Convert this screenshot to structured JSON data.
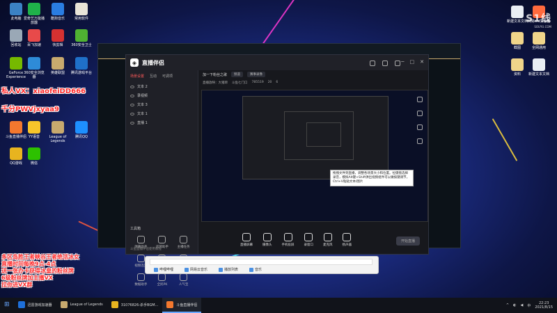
{
  "desktop_left": [
    {
      "label": "此电脑",
      "color": "#3b82c4"
    },
    {
      "label": "爱奇艺万能播放器",
      "color": "#1fb14a"
    },
    {
      "label": "酷狗音乐",
      "color": "#2a7de1"
    },
    {
      "label": "常用软件",
      "color": "#e8e4d8"
    },
    {
      "label": "回收站",
      "color": "#9aa8b6"
    },
    {
      "label": "百飞加速",
      "color": "#e84a4a"
    },
    {
      "label": "快剪辑",
      "color": "#d63131"
    },
    {
      "label": "360安全卫士",
      "color": "#4fb232"
    },
    {
      "label": "GeForce Experience",
      "color": "#76b900"
    },
    {
      "label": "360安全浏览器",
      "color": "#2e8bd8"
    },
    {
      "label": "英雄联盟",
      "color": "#c8aa6e"
    },
    {
      "label": "腾讯游戏平台",
      "color": "#1f70c9"
    },
    {
      "label": "QQ游戏",
      "color": "#e8b41f"
    },
    {
      "label": "微信",
      "color": "#2dc100"
    },
    {
      "label": "斗鱼直播伴侣",
      "color": "#f3782e"
    },
    {
      "label": "YY语音",
      "color": "#f7c52a"
    },
    {
      "label": "League of Legends",
      "color": "#c8aa6e"
    },
    {
      "label": "腾讯QQ",
      "color": "#1e90ff"
    }
  ],
  "desktop_right": [
    {
      "label": "新建文本文档",
      "color": "#e9eef4"
    },
    {
      "label": "网易UU加速器",
      "color": "#ff6a3d"
    },
    {
      "label": "截图",
      "color": "#f0d58a"
    },
    {
      "label": "全网通用",
      "color": "#f0d58a"
    },
    {
      "label": "资料",
      "color": "#f0d58a"
    },
    {
      "label": "新建文本文档",
      "color": "#e9eef4"
    }
  ],
  "overlay": {
    "line1": "私人VX：xiaofeiDD666",
    "line2": "千分PWVjxyaa9",
    "promo": [
      "多区岛胜王者峡谷王者绝活冰女",
      "直播时间每晚9点-4点",
      "送一张办卡获得冰皇的粉丝牌",
      "6级粉丝牌加主播VX",
      "拉你进VX群"
    ]
  },
  "watermark": {
    "brand": "S1线",
    "url": "SOUYU.COM"
  },
  "app": {
    "name": "直播伴侣",
    "tabs": [
      "场景设置",
      "互动",
      "可调项"
    ],
    "scenes": [
      "文本 2",
      "录视频",
      "文本 3",
      "文本 1",
      "直播 1"
    ],
    "tools_title": "工具箱",
    "tools": [
      "弹幕助手",
      "房管助手",
      "主播任务",
      "视频连麦",
      "多人连麦",
      "弹幕库",
      "数据助手",
      "全民PK",
      "人气宝",
      "直播间"
    ],
    "foot": "斗鱼直播伴侣使用教程",
    "title": "加一下粉丝之歌",
    "title_pills": [
      "频道",
      "赛事录像"
    ],
    "meta": [
      "直播放映：大猪蹄",
      "斗鱼七门口",
      "785519",
      "20",
      "6"
    ],
    "tooltip": "拖拽文件到直播，调整各场景大小和位置。拉键盘选择录音，模拟Alt键+Shift弹出视频组件可以做按键调节，Ctrl+V粘贴文本/图片",
    "bottom": [
      "直播屏幕",
      "摄像头",
      "手机投屏",
      "录窗口",
      "麦克风",
      "扬声器"
    ],
    "start": "开始直播"
  },
  "search": {
    "items": [
      "哔哩哔哩",
      "网易云音乐",
      "播放列表",
      "音乐"
    ]
  },
  "taskbar": {
    "items": [
      {
        "label": "迅雷游戏加速器",
        "color": "#1e6fd9"
      },
      {
        "label": "League of Legends",
        "color": "#c8aa6e"
      },
      {
        "label": "31076826-杀手BGM...",
        "color": "#e8b41f"
      },
      {
        "label": "斗鱼直播伴侣",
        "color": "#f3782e"
      }
    ],
    "time": "22:23",
    "date": "2021/8/15",
    "lang": "中"
  },
  "colors": {
    "accent": "#ff5a5a",
    "overlay_red": "#ff2b2b"
  }
}
